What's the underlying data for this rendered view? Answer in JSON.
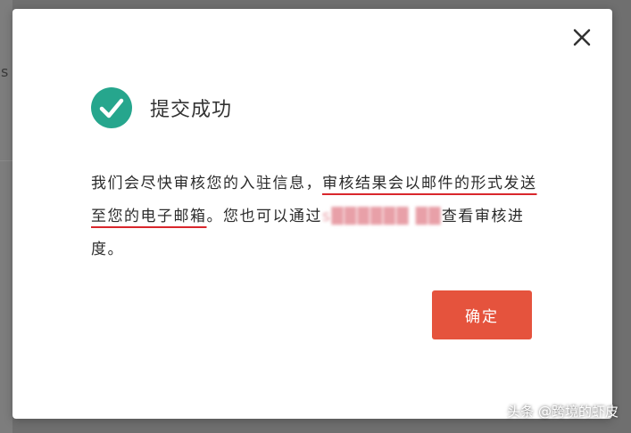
{
  "background": {
    "partial_text": "s"
  },
  "dialog": {
    "title": "提交成功",
    "message": {
      "part1": "我们会尽快审核您的入驻信息，",
      "highlight": "审核结果会以邮件的形式发送至您的电子邮箱",
      "part2": "。您也可以通过",
      "link_redacted": "s██████ ██",
      "part3": "查看审核进度。"
    },
    "confirm_label": "确定"
  },
  "watermark": "头条 @跨境的虾皮",
  "colors": {
    "success_green": "#26a68d",
    "confirm_button": "#e5533d",
    "underline_red": "#d9262c"
  },
  "icons": {
    "close": "close-icon",
    "success": "check-circle-icon"
  }
}
